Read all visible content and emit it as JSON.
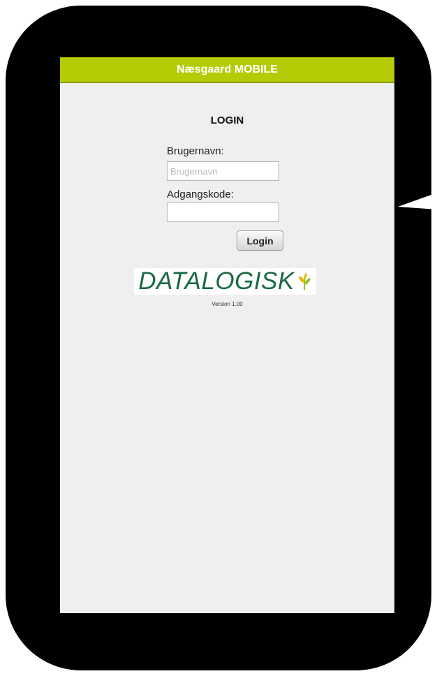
{
  "header": {
    "title": "Næsgaard MOBILE"
  },
  "login": {
    "heading": "LOGIN",
    "username_label": "Brugernavn:",
    "username_placeholder": "Brugernavn",
    "username_value": "",
    "password_label": "Adgangskode:",
    "password_value": "",
    "login_button": "Login"
  },
  "brand": {
    "logo_text": "DATALOGISK",
    "logo_icon": "wheat-leaf-icon",
    "version": "Version 1.00"
  },
  "colors": {
    "header_bar": "#b4cb06",
    "screen_background": "#efefef",
    "device_bezel": "#000000",
    "logo_green": "#1b6a43",
    "leaf_yellow": "#e2b800",
    "leaf_green": "#8cc21c"
  }
}
